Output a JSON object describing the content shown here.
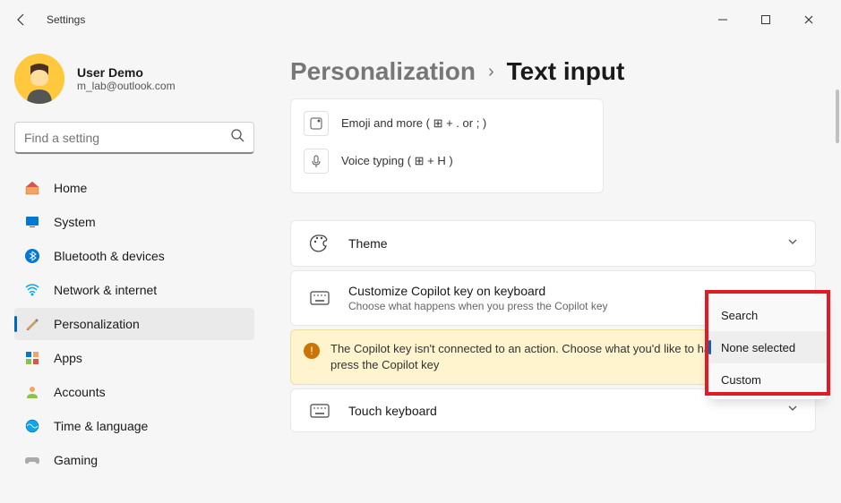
{
  "titlebar": {
    "title": "Settings"
  },
  "profile": {
    "name": "User Demo",
    "email": "m_lab@outlook.com"
  },
  "search": {
    "placeholder": "Find a setting"
  },
  "nav": {
    "items": [
      {
        "label": "Home"
      },
      {
        "label": "System"
      },
      {
        "label": "Bluetooth & devices"
      },
      {
        "label": "Network & internet"
      },
      {
        "label": "Personalization"
      },
      {
        "label": "Apps"
      },
      {
        "label": "Accounts"
      },
      {
        "label": "Time & language"
      },
      {
        "label": "Gaming"
      }
    ]
  },
  "breadcrumb": {
    "parent": "Personalization",
    "current": "Text input"
  },
  "shortcuts": {
    "emoji": "Emoji and more ( ⊞ + . or ; )",
    "voice": "Voice typing ( ⊞ + H )"
  },
  "settings": {
    "theme": {
      "title": "Theme"
    },
    "copilot": {
      "title": "Customize Copilot key on keyboard",
      "desc": "Choose what happens when you press the Copilot key"
    },
    "touch": {
      "title": "Touch keyboard"
    }
  },
  "alert": {
    "text": "The Copilot key isn't connected to an action. Choose what you'd like to happen when you press the Copilot key"
  },
  "dropdown": {
    "items": [
      {
        "label": "Search"
      },
      {
        "label": "None selected"
      },
      {
        "label": "Custom"
      }
    ]
  }
}
